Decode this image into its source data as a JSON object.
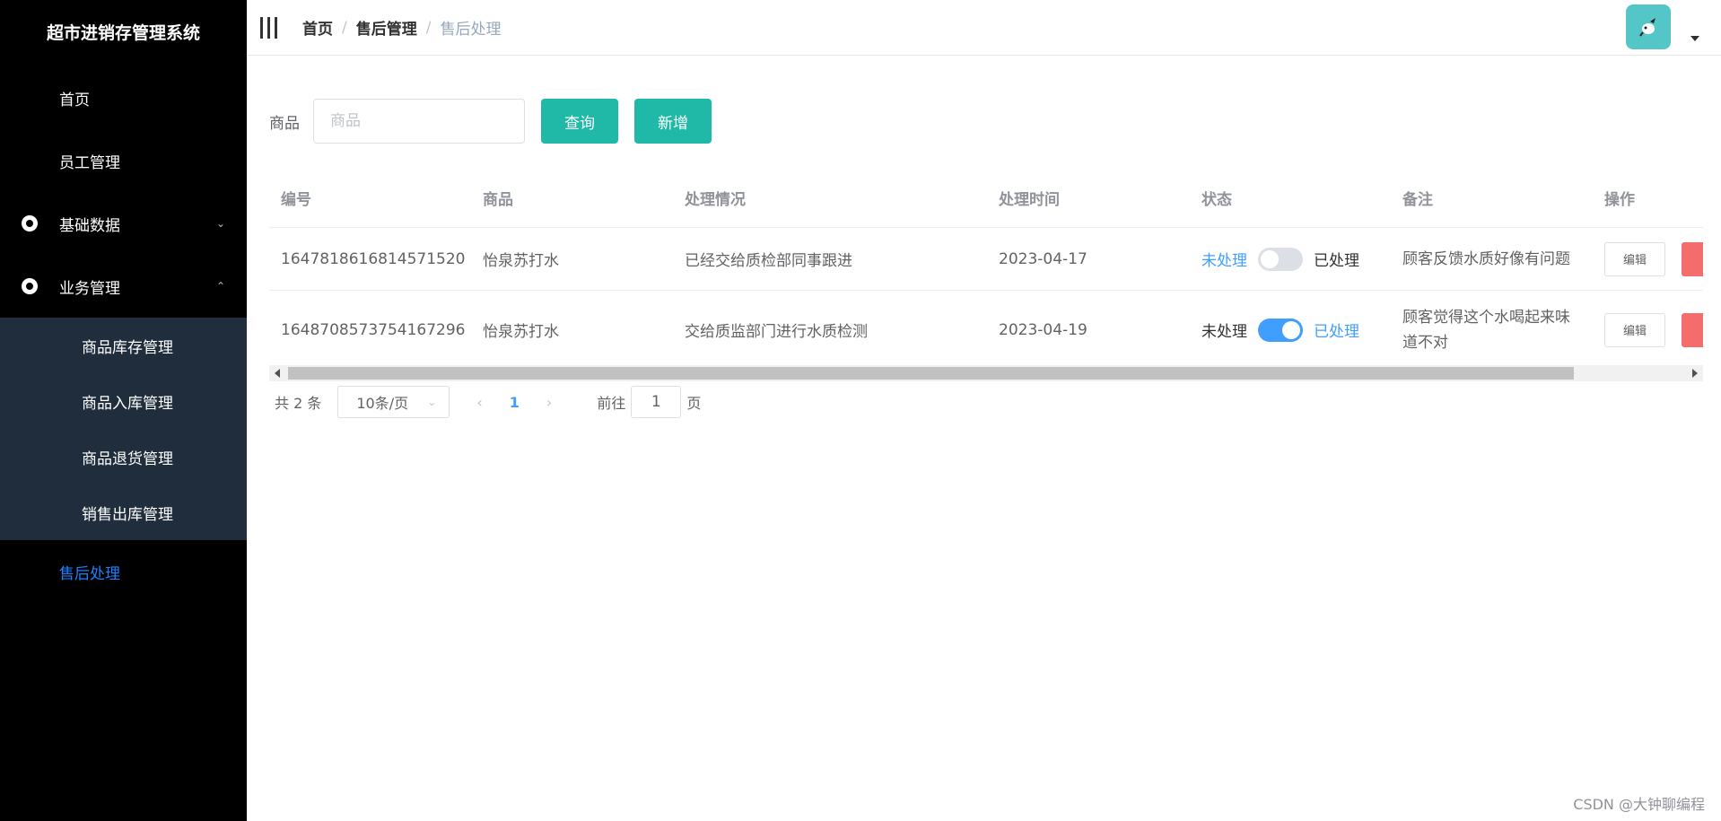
{
  "app": {
    "title": "超市进销存管理系统"
  },
  "sidebar": {
    "items": [
      {
        "label": "首页"
      },
      {
        "label": "员工管理"
      },
      {
        "label": "基础数据"
      },
      {
        "label": "业务管理"
      }
    ],
    "sub_items": [
      {
        "label": "商品库存管理"
      },
      {
        "label": "商品入库管理"
      },
      {
        "label": "商品退货管理"
      },
      {
        "label": "销售出库管理"
      }
    ],
    "active_item": {
      "label": "售后处理"
    },
    "colors": {
      "background": "#000000",
      "submenu_background": "#1f2d3d",
      "active": "#1e80ff"
    }
  },
  "header": {
    "breadcrumb": [
      "首页",
      "售后管理",
      "售后处理"
    ],
    "separator": "/"
  },
  "search": {
    "label": "商品",
    "placeholder": "商品",
    "query_label": "查询",
    "add_label": "新增"
  },
  "table": {
    "headers": [
      "编号",
      "商品",
      "处理情况",
      "处理时间",
      "状态",
      "备注",
      "操作"
    ],
    "rows": [
      {
        "id": "1647818616814571520",
        "product": "怡泉苏打水",
        "handling": "已经交给质检部同事跟进",
        "time": "2023-04-17",
        "status_off_label": "未处理",
        "status_on_label": "已处理",
        "processed": false,
        "remark": "顾客反馈水质好像有问题",
        "edit_label": "编辑"
      },
      {
        "id": "1648708573754167296",
        "product": "怡泉苏打水",
        "handling": "交给质监部门进行水质检测",
        "time": "2023-04-19",
        "status_off_label": "未处理",
        "status_on_label": "已处理",
        "processed": true,
        "remark": "顾客觉得这个水喝起来味道不对",
        "edit_label": "编辑"
      }
    ]
  },
  "pagination": {
    "total": "共 2 条",
    "page_size": "10条/页",
    "current_page": "1",
    "goto_prefix": "前往",
    "goto_value": "1",
    "goto_suffix": "页"
  },
  "watermark": "CSDN @大钟聊编程",
  "colors": {
    "primary_button": "#20b8a6",
    "link": "#409eff",
    "danger": "#f56c6c"
  }
}
